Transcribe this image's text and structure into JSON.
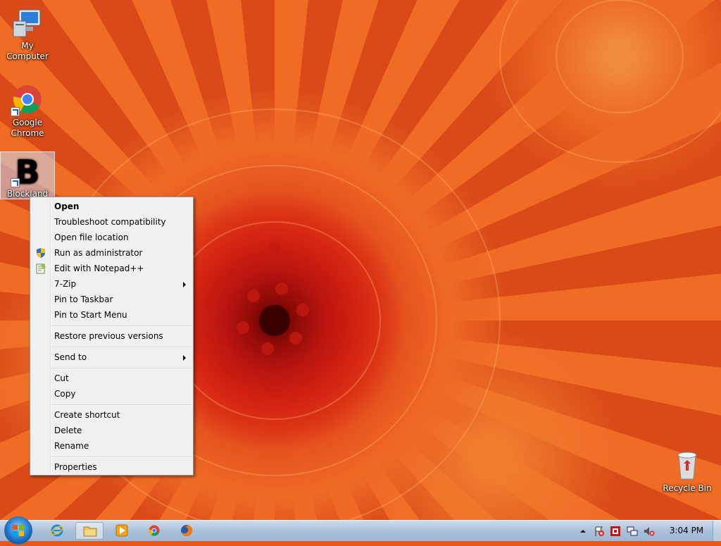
{
  "desktop": {
    "icons": [
      {
        "label": "My Computer",
        "icon": "computer-icon"
      },
      {
        "label": "Google Chrome",
        "icon": "chrome-icon"
      },
      {
        "label": "Blockland",
        "icon": "blockland-icon",
        "selected": true
      },
      {
        "label": "Recycle Bin",
        "icon": "recycle-bin-icon"
      }
    ],
    "blockland_letter": "B"
  },
  "context_menu": {
    "items": [
      {
        "label": "Open",
        "bold": true
      },
      {
        "label": "Troubleshoot compatibility"
      },
      {
        "label": "Open file location"
      },
      {
        "label": "Run as administrator",
        "icon": "shield-icon"
      },
      {
        "label": "Edit with Notepad++",
        "icon": "notepad-icon"
      },
      {
        "label": "7-Zip",
        "submenu": true
      },
      {
        "label": "Pin to Taskbar"
      },
      {
        "label": "Pin to Start Menu"
      },
      {
        "label": "Restore previous versions"
      },
      {
        "label": "Send to",
        "submenu": true
      },
      {
        "label": "Cut"
      },
      {
        "label": "Copy"
      },
      {
        "label": "Create shortcut"
      },
      {
        "label": "Delete"
      },
      {
        "label": "Rename"
      },
      {
        "label": "Properties"
      }
    ]
  },
  "taskbar": {
    "pinned": [
      {
        "icon": "internet-explorer-icon"
      },
      {
        "icon": "folder-icon",
        "active": true
      },
      {
        "icon": "media-player-icon"
      },
      {
        "icon": "chrome-icon"
      },
      {
        "icon": "firefox-icon"
      }
    ],
    "tray": [
      {
        "icon": "tray-chevron-icon"
      },
      {
        "icon": "action-center-icon"
      },
      {
        "icon": "tray-app-icon"
      },
      {
        "icon": "network-icon"
      },
      {
        "icon": "volume-muted-icon"
      }
    ],
    "clock": "3:04 PM"
  },
  "colors": {
    "wallpaper_orange": "#e8561b",
    "flower_center": "#8c0a07",
    "menu_bg": "#f0f0f0",
    "taskbar_blue": "#a9c0da"
  }
}
